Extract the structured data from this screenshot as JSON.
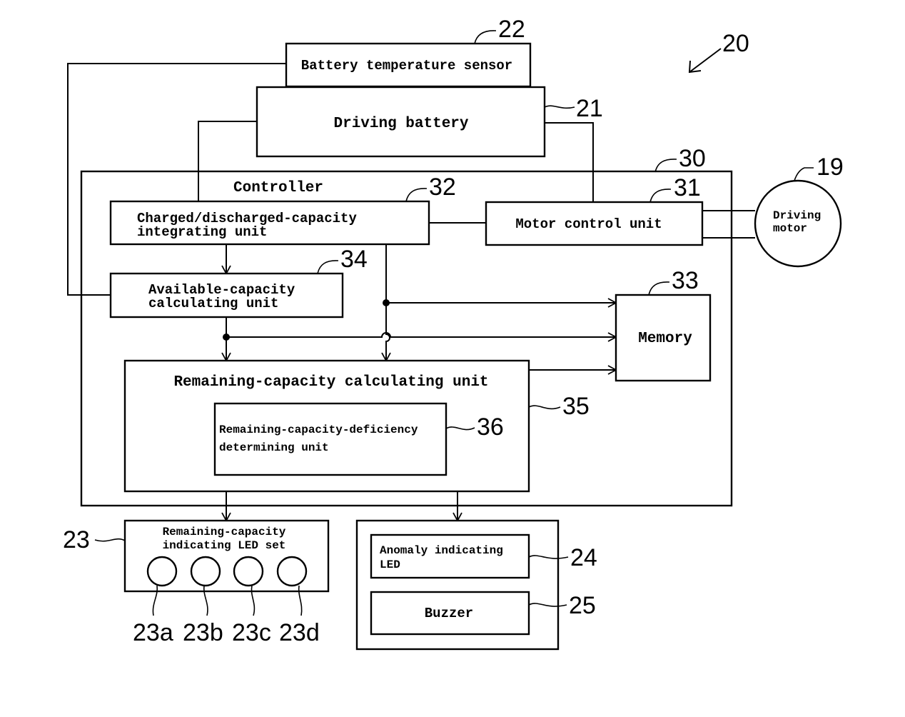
{
  "figure": {
    "reference": "20",
    "blocks": {
      "battery_temperature_sensor": {
        "label": "Battery temperature sensor",
        "ref": "22"
      },
      "driving_battery": {
        "label": "Driving battery",
        "ref": "21"
      },
      "controller": {
        "label": "Controller",
        "ref": "30"
      },
      "motor_control_unit": {
        "label": "Motor control unit",
        "ref": "31"
      },
      "driving_motor": {
        "label_line1": "Driving",
        "label_line2": "motor",
        "ref": "19"
      },
      "integrating_unit": {
        "label_line1": "Charged/discharged-capacity",
        "label_line2": "integrating unit",
        "ref": "32"
      },
      "memory": {
        "label": "Memory",
        "ref": "33"
      },
      "available_capacity_unit": {
        "label_line1": "Available-capacity",
        "label_line2": "calculating unit",
        "ref": "34"
      },
      "remaining_capacity_unit": {
        "label": "Remaining-capacity calculating unit",
        "ref": "35"
      },
      "deficiency_unit": {
        "label_line1": "Remaining-capacity-deficiency",
        "label_line2": "determining unit",
        "ref": "36"
      },
      "led_set": {
        "label_line1": "Remaining-capacity",
        "label_line2": "indicating LED set",
        "ref": "23",
        "leds": [
          {
            "ref": "23a"
          },
          {
            "ref": "23b"
          },
          {
            "ref": "23c"
          },
          {
            "ref": "23d"
          }
        ]
      },
      "anomaly_led": {
        "label_line1": "Anomaly indicating",
        "label_line2": "LED",
        "ref": "24"
      },
      "buzzer": {
        "label": "Buzzer",
        "ref": "25"
      }
    }
  }
}
